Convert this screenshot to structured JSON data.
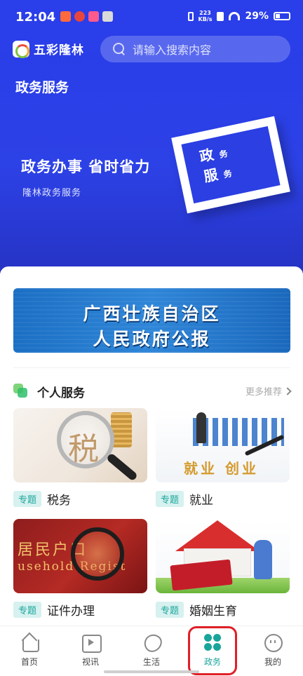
{
  "status_bar": {
    "time": "12:04",
    "net_speed_value": "223",
    "net_speed_unit": "KB/s",
    "battery": "29%"
  },
  "header": {
    "app_name": "五彩隆林",
    "search_placeholder": "请输入搜索内容"
  },
  "hero": {
    "page_title": "政务服务",
    "slogan": "政务办事 省时省力",
    "sub_slogan": "隆林政务服务",
    "emblem_big1": "政",
    "emblem_small1": "务",
    "emblem_big2": "服",
    "emblem_small2": "务"
  },
  "banner": {
    "line1": "广西壮族自治区",
    "line2": "人民政府公报"
  },
  "section": {
    "title": "个人服务",
    "more": "更多推荐"
  },
  "cards": [
    {
      "tag": "专题",
      "name": "税务",
      "art_text": "税"
    },
    {
      "tag": "专题",
      "name": "就业",
      "art_text": "就业 创业"
    },
    {
      "tag": "专题",
      "name": "证件办理",
      "art_text": "居民户口",
      "art_text2": "usehold Regist"
    },
    {
      "tag": "专题",
      "name": "婚姻生育"
    }
  ],
  "bottom_nav": [
    {
      "label": "首页",
      "icon": "home-icon"
    },
    {
      "label": "视讯",
      "icon": "video-icon"
    },
    {
      "label": "生活",
      "icon": "heart-hands-icon"
    },
    {
      "label": "政务",
      "icon": "clover-icon",
      "active": true
    },
    {
      "label": "我的",
      "icon": "smile-face-icon"
    }
  ],
  "colors": {
    "brand_blue": "#2a3ee9",
    "accent_teal": "#1aa59b",
    "highlight_red": "#e01f26"
  }
}
